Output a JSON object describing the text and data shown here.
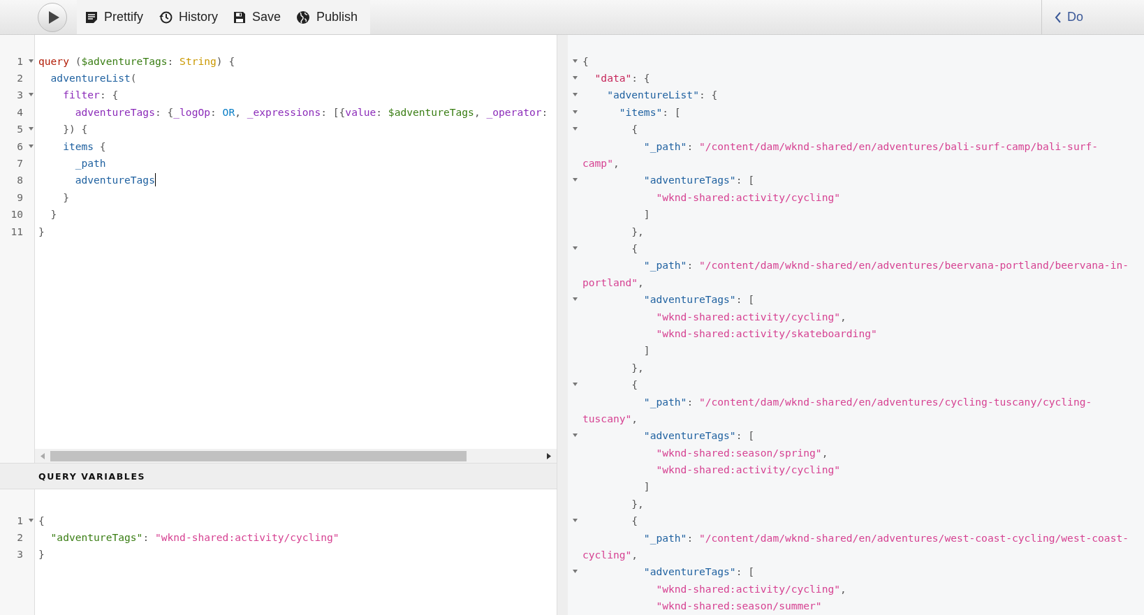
{
  "toolbar": {
    "buttons": [
      {
        "label": "Prettify"
      },
      {
        "label": "History"
      },
      {
        "label": "Save"
      },
      {
        "label": "Publish"
      }
    ],
    "docs": {
      "label": "Do"
    }
  },
  "query": {
    "lines": [
      {
        "number": "1",
        "foldable": true,
        "cursor": false,
        "tokens": [
          {
            "text": "query",
            "kind": "keyword"
          },
          {
            "text": " (",
            "kind": "punct"
          },
          {
            "text": "$adventureTags",
            "kind": "variable"
          },
          {
            "text": ": ",
            "kind": "punct"
          },
          {
            "text": "String",
            "kind": "type"
          },
          {
            "text": ") {",
            "kind": "punct"
          }
        ]
      },
      {
        "number": "2",
        "foldable": false,
        "cursor": false,
        "tokens": [
          {
            "text": "  adventureList",
            "kind": "field"
          },
          {
            "text": "(",
            "kind": "punct"
          }
        ]
      },
      {
        "number": "3",
        "foldable": true,
        "cursor": false,
        "tokens": [
          {
            "text": "    filter",
            "kind": "attr"
          },
          {
            "text": ": {",
            "kind": "punct"
          }
        ]
      },
      {
        "number": "4",
        "foldable": false,
        "cursor": false,
        "tokens": [
          {
            "text": "      adventureTags",
            "kind": "attr"
          },
          {
            "text": ": {",
            "kind": "punct"
          },
          {
            "text": "_logOp",
            "kind": "attr"
          },
          {
            "text": ": ",
            "kind": "punct"
          },
          {
            "text": "OR",
            "kind": "enum"
          },
          {
            "text": ", ",
            "kind": "punct"
          },
          {
            "text": "_expressions",
            "kind": "attr"
          },
          {
            "text": ": [{",
            "kind": "punct"
          },
          {
            "text": "value",
            "kind": "attr"
          },
          {
            "text": ": ",
            "kind": "punct"
          },
          {
            "text": "$adventureTags",
            "kind": "variable"
          },
          {
            "text": ", ",
            "kind": "punct"
          },
          {
            "text": "_operator",
            "kind": "attr"
          },
          {
            "text": ":",
            "kind": "punct"
          }
        ]
      },
      {
        "number": "5",
        "foldable": true,
        "cursor": false,
        "tokens": [
          {
            "text": "    }) {",
            "kind": "punct"
          }
        ]
      },
      {
        "number": "6",
        "foldable": true,
        "cursor": false,
        "tokens": [
          {
            "text": "    items",
            "kind": "field"
          },
          {
            "text": " {",
            "kind": "punct"
          }
        ]
      },
      {
        "number": "7",
        "foldable": false,
        "cursor": false,
        "tokens": [
          {
            "text": "      _path",
            "kind": "field"
          }
        ]
      },
      {
        "number": "8",
        "foldable": false,
        "cursor": true,
        "tokens": [
          {
            "text": "      adventureTags",
            "kind": "field"
          }
        ]
      },
      {
        "number": "9",
        "foldable": false,
        "cursor": false,
        "tokens": [
          {
            "text": "    }",
            "kind": "punct"
          }
        ]
      },
      {
        "number": "10",
        "foldable": false,
        "cursor": false,
        "tokens": [
          {
            "text": "  }",
            "kind": "punct"
          }
        ]
      },
      {
        "number": "11",
        "foldable": false,
        "cursor": false,
        "tokens": [
          {
            "text": "}",
            "kind": "punct"
          }
        ]
      }
    ]
  },
  "variables": {
    "title": "QUERY VARIABLES",
    "lines": [
      {
        "number": "1",
        "foldable": true,
        "tokens": [
          {
            "text": "{",
            "kind": "punct"
          }
        ]
      },
      {
        "number": "2",
        "foldable": false,
        "tokens": [
          {
            "text": "  \"adventureTags\"",
            "kind": "varkey"
          },
          {
            "text": ": ",
            "kind": "punct"
          },
          {
            "text": "\"wknd-shared:activity/cycling\"",
            "kind": "string"
          }
        ]
      },
      {
        "number": "3",
        "foldable": false,
        "tokens": [
          {
            "text": "}",
            "kind": "punct"
          }
        ]
      }
    ]
  },
  "result": {
    "lines": [
      {
        "foldable": true,
        "tokens": [
          {
            "text": "{",
            "kind": "punct"
          }
        ]
      },
      {
        "foldable": true,
        "tokens": [
          {
            "text": "  \"data\"",
            "kind": "rootkey"
          },
          {
            "text": ": {",
            "kind": "punct"
          }
        ]
      },
      {
        "foldable": true,
        "tokens": [
          {
            "text": "    \"adventureList\"",
            "kind": "key"
          },
          {
            "text": ": {",
            "kind": "punct"
          }
        ]
      },
      {
        "foldable": true,
        "tokens": [
          {
            "text": "      \"items\"",
            "kind": "key"
          },
          {
            "text": ": [",
            "kind": "punct"
          }
        ]
      },
      {
        "foldable": true,
        "tokens": [
          {
            "text": "        {",
            "kind": "punct"
          }
        ]
      },
      {
        "foldable": false,
        "tokens": [
          {
            "text": "          \"_path\"",
            "kind": "key"
          },
          {
            "text": ": ",
            "kind": "punct"
          },
          {
            "text": "\"/content/dam/wknd-shared/en/adventures/bali-surf-camp/bali-surf-",
            "kind": "string"
          }
        ]
      },
      {
        "foldable": false,
        "tokens": [
          {
            "text": "camp\"",
            "kind": "string"
          },
          {
            "text": ",",
            "kind": "punct"
          }
        ]
      },
      {
        "foldable": true,
        "tokens": [
          {
            "text": "          \"adventureTags\"",
            "kind": "key"
          },
          {
            "text": ": [",
            "kind": "punct"
          }
        ]
      },
      {
        "foldable": false,
        "tokens": [
          {
            "text": "            \"wknd-shared:activity/cycling\"",
            "kind": "string"
          }
        ]
      },
      {
        "foldable": false,
        "tokens": [
          {
            "text": "          ]",
            "kind": "punct"
          }
        ]
      },
      {
        "foldable": false,
        "tokens": [
          {
            "text": "        },",
            "kind": "punct"
          }
        ]
      },
      {
        "foldable": true,
        "tokens": [
          {
            "text": "        {",
            "kind": "punct"
          }
        ]
      },
      {
        "foldable": false,
        "tokens": [
          {
            "text": "          \"_path\"",
            "kind": "key"
          },
          {
            "text": ": ",
            "kind": "punct"
          },
          {
            "text": "\"/content/dam/wknd-shared/en/adventures/beervana-portland/beervana-in-",
            "kind": "string"
          }
        ]
      },
      {
        "foldable": false,
        "tokens": [
          {
            "text": "portland\"",
            "kind": "string"
          },
          {
            "text": ",",
            "kind": "punct"
          }
        ]
      },
      {
        "foldable": true,
        "tokens": [
          {
            "text": "          \"adventureTags\"",
            "kind": "key"
          },
          {
            "text": ": [",
            "kind": "punct"
          }
        ]
      },
      {
        "foldable": false,
        "tokens": [
          {
            "text": "            \"wknd-shared:activity/cycling\"",
            "kind": "string"
          },
          {
            "text": ",",
            "kind": "punct"
          }
        ]
      },
      {
        "foldable": false,
        "tokens": [
          {
            "text": "            \"wknd-shared:activity/skateboarding\"",
            "kind": "string"
          }
        ]
      },
      {
        "foldable": false,
        "tokens": [
          {
            "text": "          ]",
            "kind": "punct"
          }
        ]
      },
      {
        "foldable": false,
        "tokens": [
          {
            "text": "        },",
            "kind": "punct"
          }
        ]
      },
      {
        "foldable": true,
        "tokens": [
          {
            "text": "        {",
            "kind": "punct"
          }
        ]
      },
      {
        "foldable": false,
        "tokens": [
          {
            "text": "          \"_path\"",
            "kind": "key"
          },
          {
            "text": ": ",
            "kind": "punct"
          },
          {
            "text": "\"/content/dam/wknd-shared/en/adventures/cycling-tuscany/cycling-",
            "kind": "string"
          }
        ]
      },
      {
        "foldable": false,
        "tokens": [
          {
            "text": "tuscany\"",
            "kind": "string"
          },
          {
            "text": ",",
            "kind": "punct"
          }
        ]
      },
      {
        "foldable": true,
        "tokens": [
          {
            "text": "          \"adventureTags\"",
            "kind": "key"
          },
          {
            "text": ": [",
            "kind": "punct"
          }
        ]
      },
      {
        "foldable": false,
        "tokens": [
          {
            "text": "            \"wknd-shared:season/spring\"",
            "kind": "string"
          },
          {
            "text": ",",
            "kind": "punct"
          }
        ]
      },
      {
        "foldable": false,
        "tokens": [
          {
            "text": "            \"wknd-shared:activity/cycling\"",
            "kind": "string"
          }
        ]
      },
      {
        "foldable": false,
        "tokens": [
          {
            "text": "          ]",
            "kind": "punct"
          }
        ]
      },
      {
        "foldable": false,
        "tokens": [
          {
            "text": "        },",
            "kind": "punct"
          }
        ]
      },
      {
        "foldable": true,
        "tokens": [
          {
            "text": "        {",
            "kind": "punct"
          }
        ]
      },
      {
        "foldable": false,
        "tokens": [
          {
            "text": "          \"_path\"",
            "kind": "key"
          },
          {
            "text": ": ",
            "kind": "punct"
          },
          {
            "text": "\"/content/dam/wknd-shared/en/adventures/west-coast-cycling/west-coast-",
            "kind": "string"
          }
        ]
      },
      {
        "foldable": false,
        "tokens": [
          {
            "text": "cycling\"",
            "kind": "string"
          },
          {
            "text": ",",
            "kind": "punct"
          }
        ]
      },
      {
        "foldable": true,
        "tokens": [
          {
            "text": "          \"adventureTags\"",
            "kind": "key"
          },
          {
            "text": ": [",
            "kind": "punct"
          }
        ]
      },
      {
        "foldable": false,
        "tokens": [
          {
            "text": "            \"wknd-shared:activity/cycling\"",
            "kind": "string"
          },
          {
            "text": ",",
            "kind": "punct"
          }
        ]
      },
      {
        "foldable": false,
        "tokens": [
          {
            "text": "            \"wknd-shared:season/summer\"",
            "kind": "string"
          }
        ]
      }
    ]
  }
}
